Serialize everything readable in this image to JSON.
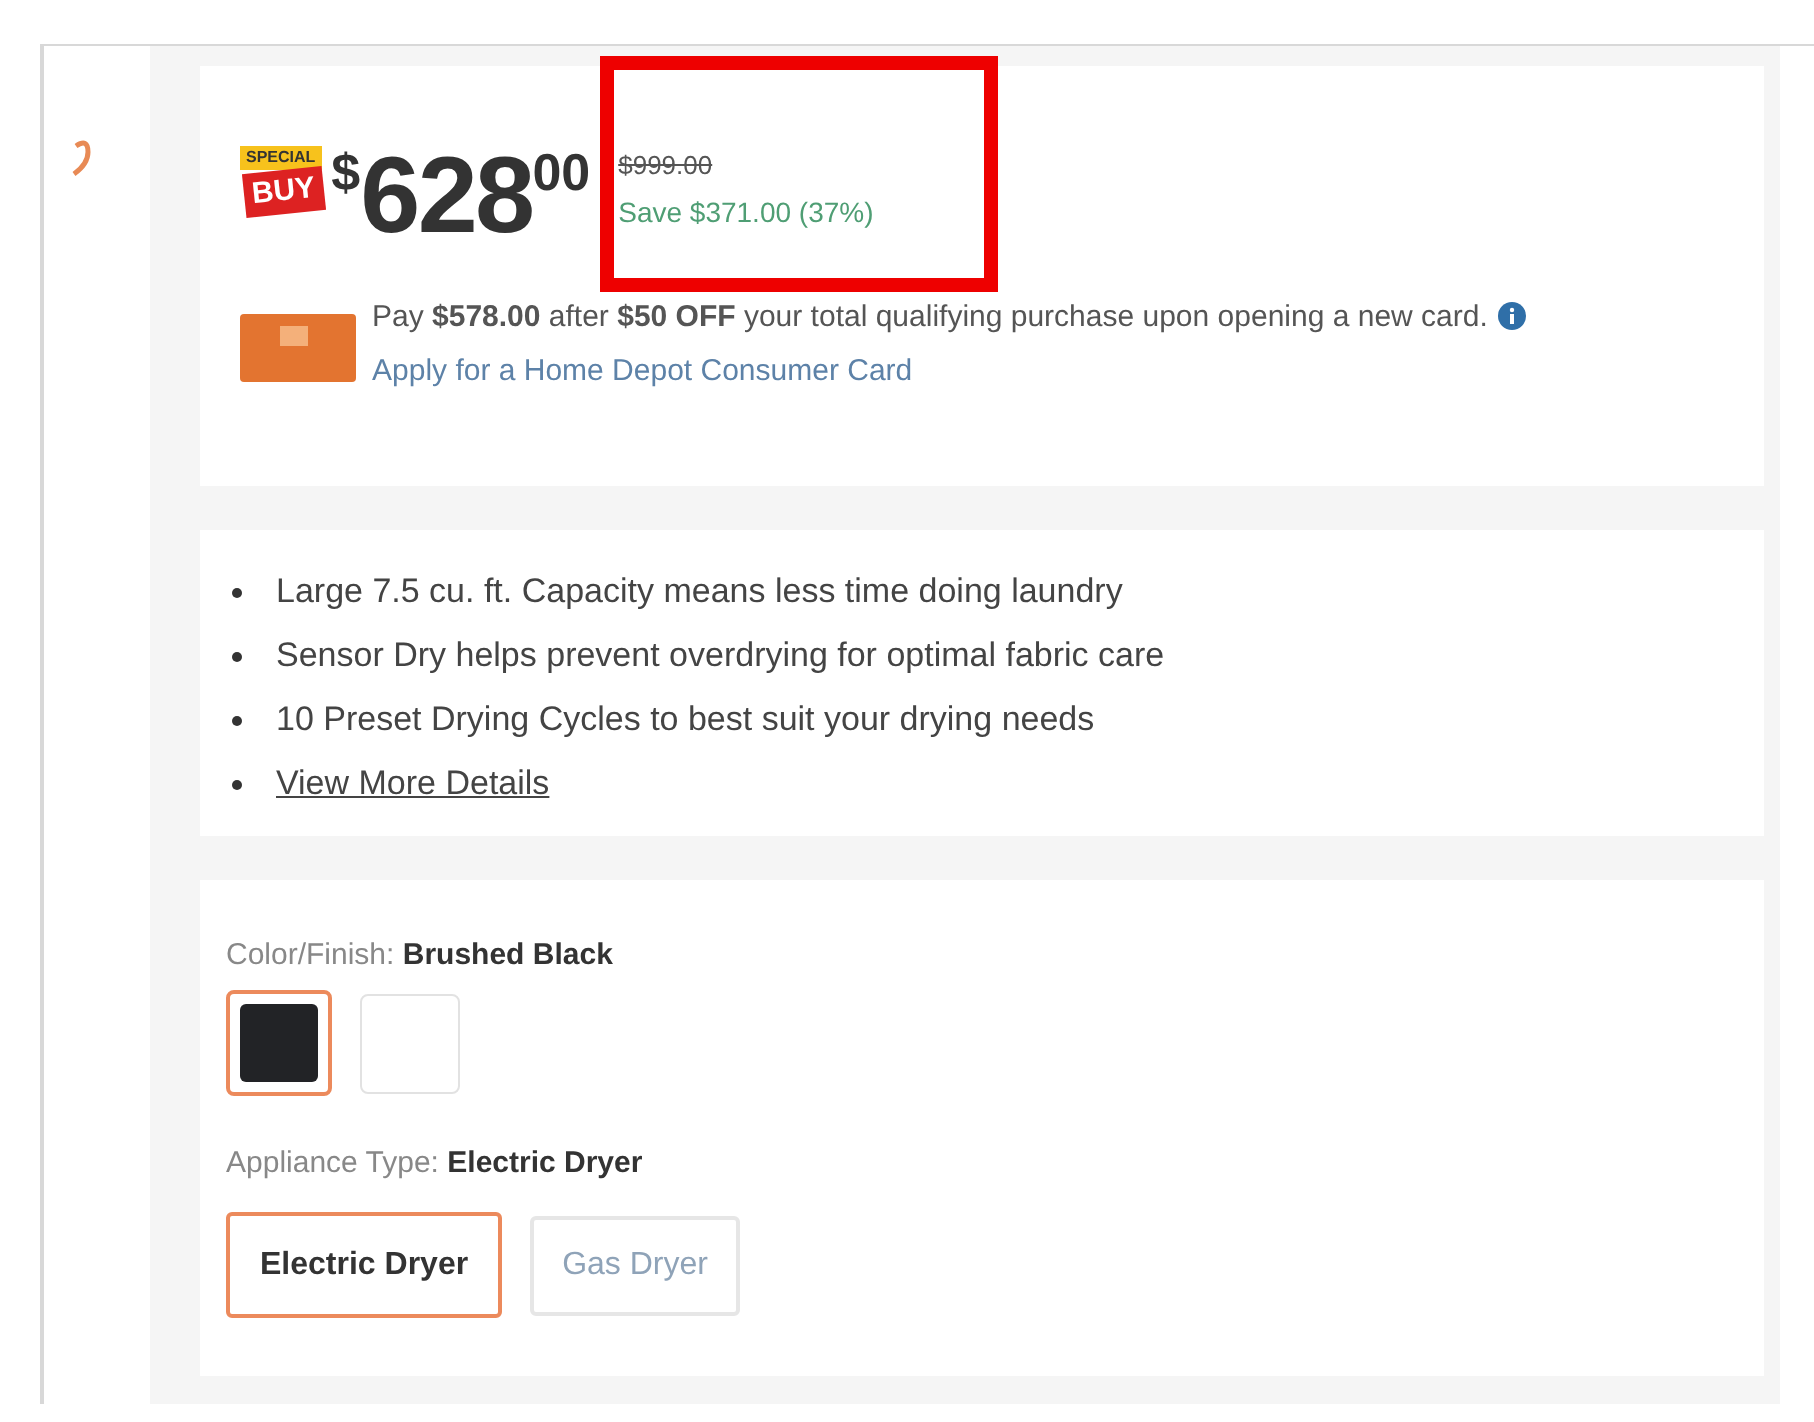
{
  "price": {
    "badge_top": "SPECIAL",
    "badge_bottom": "BUY",
    "currency": "$",
    "dollars": "628",
    "cents": "00",
    "was": "$999.00",
    "save": "Save $371.00 (37%)",
    "highlighted": true
  },
  "offer": {
    "text": "Pay **$578.00** after **$50 OFF** your total qualifying purchase upon opening a new card.",
    "link": "Apply for a Home Depot Consumer Card"
  },
  "features": [
    {
      "kind": "text",
      "text": "Large 7.5 cu. ft. Capacity means less time doing laundry"
    },
    {
      "kind": "text",
      "text": "Sensor Dry helps prevent overdrying for optimal fabric care"
    },
    {
      "kind": "text",
      "text": "10 Preset Drying Cycles to best suit your drying needs"
    },
    {
      "kind": "link",
      "text": "View More Details"
    }
  ],
  "color_finish": {
    "label": "Color/Finish:",
    "value": "Brushed Black",
    "swatches": [
      {
        "color": "#222326",
        "selected": true
      },
      {
        "color": "#ffffff",
        "selected": false
      }
    ]
  },
  "appliance_type": {
    "label": "Appliance Type:",
    "value": "Electric Dryer",
    "options": [
      {
        "label": "Electric Dryer",
        "selected": true
      },
      {
        "label": "Gas Dryer",
        "selected": false
      }
    ]
  }
}
